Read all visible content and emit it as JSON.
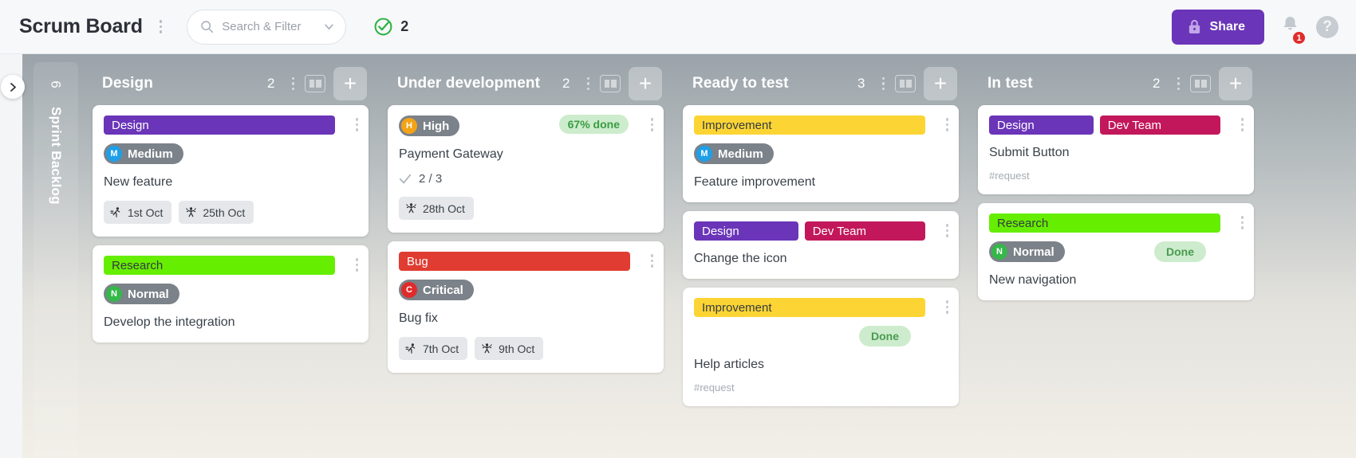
{
  "header": {
    "title": "Scrum Board",
    "search": {
      "placeholder": "Search & Filter"
    },
    "check_count": "2",
    "share_label": "Share",
    "notification_badge": "1",
    "help_label": "?"
  },
  "colors": {
    "accent_purple": "#6a35b8",
    "label_design": "#6a35b8",
    "label_dev_team": "#c2185b",
    "label_bug": "#e03c31",
    "label_improvement": "#fcd535",
    "label_research": "#66ee00",
    "prio_high": "#f5a314",
    "prio_medium": "#1e9fe8",
    "prio_normal": "#35b74a",
    "prio_critical": "#e02b2b",
    "done_green": "#4a9b51",
    "badge_red": "#e02b2b"
  },
  "backlog_column": {
    "title": "Sprint Backlog",
    "count": "6"
  },
  "columns": [
    {
      "title": "Design",
      "count": "2",
      "cards": [
        {
          "labels": [
            {
              "text": "Design",
              "color": "#6a35b8",
              "dark_text": false
            }
          ],
          "priority": {
            "letter": "M",
            "text": "Medium",
            "color": "#1e9fe8"
          },
          "title": "New feature",
          "dates": [
            {
              "icon": "start-date-icon",
              "text": "1st Oct"
            },
            {
              "icon": "end-date-icon",
              "text": "25th Oct"
            }
          ]
        },
        {
          "labels": [
            {
              "text": "Research",
              "color": "#66ee00",
              "dark_text": true
            }
          ],
          "priority": {
            "letter": "N",
            "text": "Normal",
            "color": "#35b74a"
          },
          "title": "Develop the integration"
        }
      ]
    },
    {
      "title": "Under development",
      "count": "2",
      "cards": [
        {
          "priority": {
            "letter": "H",
            "text": "High",
            "color": "#f5a314"
          },
          "progress": "67% done",
          "title": "Payment Gateway",
          "subtask": "2 / 3",
          "dates": [
            {
              "icon": "end-date-icon",
              "text": "28th Oct"
            }
          ]
        },
        {
          "labels": [
            {
              "text": "Bug",
              "color": "#e03c31",
              "dark_text": false
            }
          ],
          "priority": {
            "letter": "C",
            "text": "Critical",
            "color": "#e02b2b"
          },
          "title": "Bug fix",
          "dates": [
            {
              "icon": "start-date-icon",
              "text": "7th Oct"
            },
            {
              "icon": "end-date-icon",
              "text": "9th Oct"
            }
          ]
        }
      ]
    },
    {
      "title": "Ready to test",
      "count": "3",
      "cards": [
        {
          "labels": [
            {
              "text": "Improvement",
              "color": "#fcd535",
              "dark_text": true
            }
          ],
          "priority": {
            "letter": "M",
            "text": "Medium",
            "color": "#1e9fe8"
          },
          "title": "Feature improvement"
        },
        {
          "labels": [
            {
              "text": "Design",
              "color": "#6a35b8",
              "dark_text": false
            },
            {
              "text": "Dev Team",
              "color": "#c2185b",
              "dark_text": false
            }
          ],
          "title": "Change the icon"
        },
        {
          "labels": [
            {
              "text": "Improvement",
              "color": "#fcd535",
              "dark_text": true
            }
          ],
          "status": "Done",
          "title": "Help articles",
          "tag": "#request"
        }
      ]
    },
    {
      "title": "In test",
      "count": "2",
      "cards": [
        {
          "labels": [
            {
              "text": "Design",
              "color": "#6a35b8",
              "dark_text": false
            },
            {
              "text": "Dev Team",
              "color": "#c2185b",
              "dark_text": false
            }
          ],
          "title": "Submit Button",
          "tag": "#request"
        },
        {
          "labels": [
            {
              "text": "Research",
              "color": "#66ee00",
              "dark_text": true
            }
          ],
          "priority": {
            "letter": "N",
            "text": "Normal",
            "color": "#35b74a"
          },
          "status": "Done",
          "title": "New navigation"
        }
      ]
    }
  ]
}
